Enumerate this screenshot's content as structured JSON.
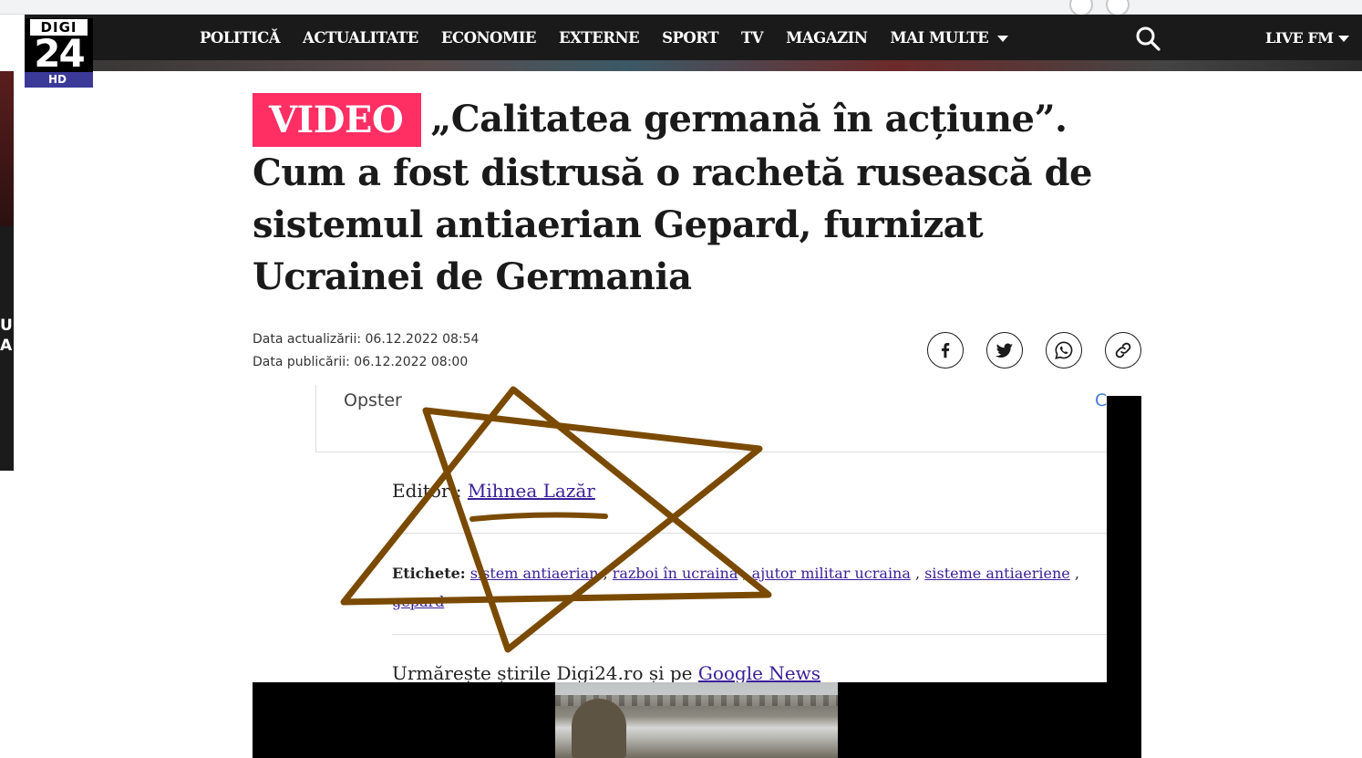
{
  "nav": {
    "logo_top": "DIGI",
    "logo_main": "24",
    "logo_hd": "HD",
    "items": [
      "POLITICĂ",
      "ACTUALITATE",
      "ECONOMIE",
      "EXTERNE",
      "SPORT",
      "TV",
      "MAGAZIN",
      "MAI MULTE"
    ],
    "live_fm": "LIVE FM"
  },
  "left_strip_text": "U\nA",
  "article": {
    "badge": "VIDEO",
    "title": "„Calitatea germană în acțiune”. Cum a fost distrusă o rachetă rusească de sistemul antiaerian Gepard, furnizat Ucrainei de Germania",
    "updated": "Data actualizării: 06.12.2022 08:54",
    "published": "Data publicării: 06.12.2022 08:00"
  },
  "share": [
    "facebook-icon",
    "twitter-icon",
    "whatsapp-icon",
    "link-icon"
  ],
  "embed": {
    "opster": "Opster",
    "opster_partial": "C",
    "editor_label": "Editor : ",
    "editor_name": "Mihnea Lazăr",
    "tags_label": "Etichete:",
    "tags": [
      "sistem antiaerian",
      "razboi în ucraina",
      "ajutor militar ucraina",
      "sisteme antiaeriene",
      "gepard"
    ],
    "follow_text": "Urmărește știrile Digi24.ro și pe ",
    "follow_link": "Google News"
  },
  "colors": {
    "badge": "#ff2e63",
    "navbar": "#1a1a1a",
    "link": "#3a1f9a",
    "star_stroke": "#7a4a00"
  }
}
